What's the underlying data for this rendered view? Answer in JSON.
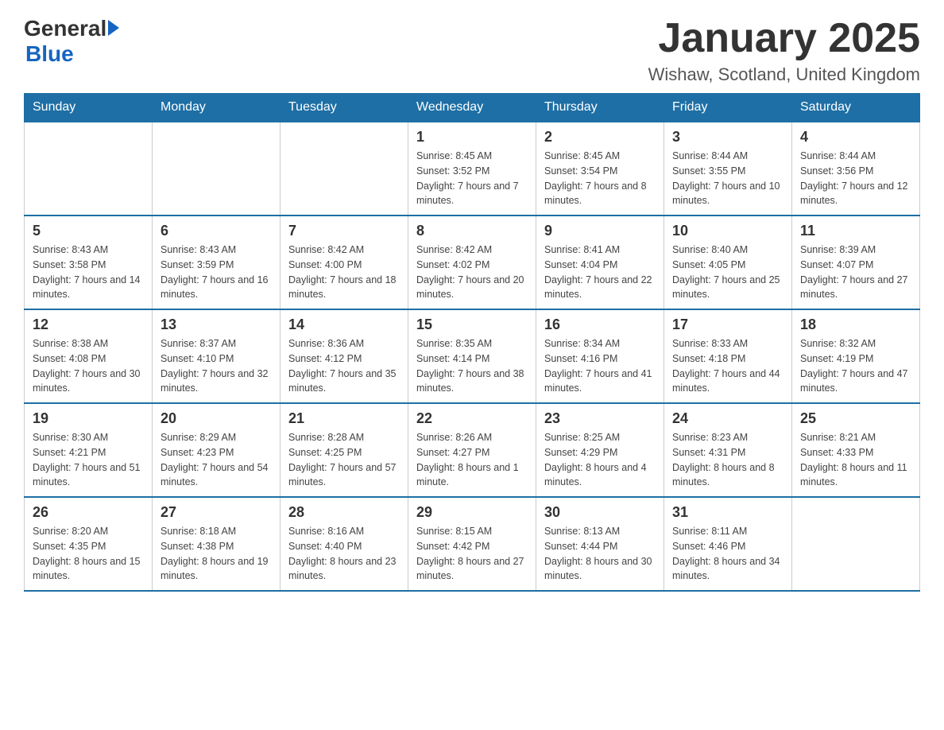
{
  "header": {
    "logo_general": "General",
    "logo_blue": "Blue",
    "month_title": "January 2025",
    "location": "Wishaw, Scotland, United Kingdom"
  },
  "days_of_week": [
    "Sunday",
    "Monday",
    "Tuesday",
    "Wednesday",
    "Thursday",
    "Friday",
    "Saturday"
  ],
  "weeks": [
    [
      {
        "day": "",
        "info": ""
      },
      {
        "day": "",
        "info": ""
      },
      {
        "day": "",
        "info": ""
      },
      {
        "day": "1",
        "info": "Sunrise: 8:45 AM\nSunset: 3:52 PM\nDaylight: 7 hours and 7 minutes."
      },
      {
        "day": "2",
        "info": "Sunrise: 8:45 AM\nSunset: 3:54 PM\nDaylight: 7 hours and 8 minutes."
      },
      {
        "day": "3",
        "info": "Sunrise: 8:44 AM\nSunset: 3:55 PM\nDaylight: 7 hours and 10 minutes."
      },
      {
        "day": "4",
        "info": "Sunrise: 8:44 AM\nSunset: 3:56 PM\nDaylight: 7 hours and 12 minutes."
      }
    ],
    [
      {
        "day": "5",
        "info": "Sunrise: 8:43 AM\nSunset: 3:58 PM\nDaylight: 7 hours and 14 minutes."
      },
      {
        "day": "6",
        "info": "Sunrise: 8:43 AM\nSunset: 3:59 PM\nDaylight: 7 hours and 16 minutes."
      },
      {
        "day": "7",
        "info": "Sunrise: 8:42 AM\nSunset: 4:00 PM\nDaylight: 7 hours and 18 minutes."
      },
      {
        "day": "8",
        "info": "Sunrise: 8:42 AM\nSunset: 4:02 PM\nDaylight: 7 hours and 20 minutes."
      },
      {
        "day": "9",
        "info": "Sunrise: 8:41 AM\nSunset: 4:04 PM\nDaylight: 7 hours and 22 minutes."
      },
      {
        "day": "10",
        "info": "Sunrise: 8:40 AM\nSunset: 4:05 PM\nDaylight: 7 hours and 25 minutes."
      },
      {
        "day": "11",
        "info": "Sunrise: 8:39 AM\nSunset: 4:07 PM\nDaylight: 7 hours and 27 minutes."
      }
    ],
    [
      {
        "day": "12",
        "info": "Sunrise: 8:38 AM\nSunset: 4:08 PM\nDaylight: 7 hours and 30 minutes."
      },
      {
        "day": "13",
        "info": "Sunrise: 8:37 AM\nSunset: 4:10 PM\nDaylight: 7 hours and 32 minutes."
      },
      {
        "day": "14",
        "info": "Sunrise: 8:36 AM\nSunset: 4:12 PM\nDaylight: 7 hours and 35 minutes."
      },
      {
        "day": "15",
        "info": "Sunrise: 8:35 AM\nSunset: 4:14 PM\nDaylight: 7 hours and 38 minutes."
      },
      {
        "day": "16",
        "info": "Sunrise: 8:34 AM\nSunset: 4:16 PM\nDaylight: 7 hours and 41 minutes."
      },
      {
        "day": "17",
        "info": "Sunrise: 8:33 AM\nSunset: 4:18 PM\nDaylight: 7 hours and 44 minutes."
      },
      {
        "day": "18",
        "info": "Sunrise: 8:32 AM\nSunset: 4:19 PM\nDaylight: 7 hours and 47 minutes."
      }
    ],
    [
      {
        "day": "19",
        "info": "Sunrise: 8:30 AM\nSunset: 4:21 PM\nDaylight: 7 hours and 51 minutes."
      },
      {
        "day": "20",
        "info": "Sunrise: 8:29 AM\nSunset: 4:23 PM\nDaylight: 7 hours and 54 minutes."
      },
      {
        "day": "21",
        "info": "Sunrise: 8:28 AM\nSunset: 4:25 PM\nDaylight: 7 hours and 57 minutes."
      },
      {
        "day": "22",
        "info": "Sunrise: 8:26 AM\nSunset: 4:27 PM\nDaylight: 8 hours and 1 minute."
      },
      {
        "day": "23",
        "info": "Sunrise: 8:25 AM\nSunset: 4:29 PM\nDaylight: 8 hours and 4 minutes."
      },
      {
        "day": "24",
        "info": "Sunrise: 8:23 AM\nSunset: 4:31 PM\nDaylight: 8 hours and 8 minutes."
      },
      {
        "day": "25",
        "info": "Sunrise: 8:21 AM\nSunset: 4:33 PM\nDaylight: 8 hours and 11 minutes."
      }
    ],
    [
      {
        "day": "26",
        "info": "Sunrise: 8:20 AM\nSunset: 4:35 PM\nDaylight: 8 hours and 15 minutes."
      },
      {
        "day": "27",
        "info": "Sunrise: 8:18 AM\nSunset: 4:38 PM\nDaylight: 8 hours and 19 minutes."
      },
      {
        "day": "28",
        "info": "Sunrise: 8:16 AM\nSunset: 4:40 PM\nDaylight: 8 hours and 23 minutes."
      },
      {
        "day": "29",
        "info": "Sunrise: 8:15 AM\nSunset: 4:42 PM\nDaylight: 8 hours and 27 minutes."
      },
      {
        "day": "30",
        "info": "Sunrise: 8:13 AM\nSunset: 4:44 PM\nDaylight: 8 hours and 30 minutes."
      },
      {
        "day": "31",
        "info": "Sunrise: 8:11 AM\nSunset: 4:46 PM\nDaylight: 8 hours and 34 minutes."
      },
      {
        "day": "",
        "info": ""
      }
    ]
  ]
}
